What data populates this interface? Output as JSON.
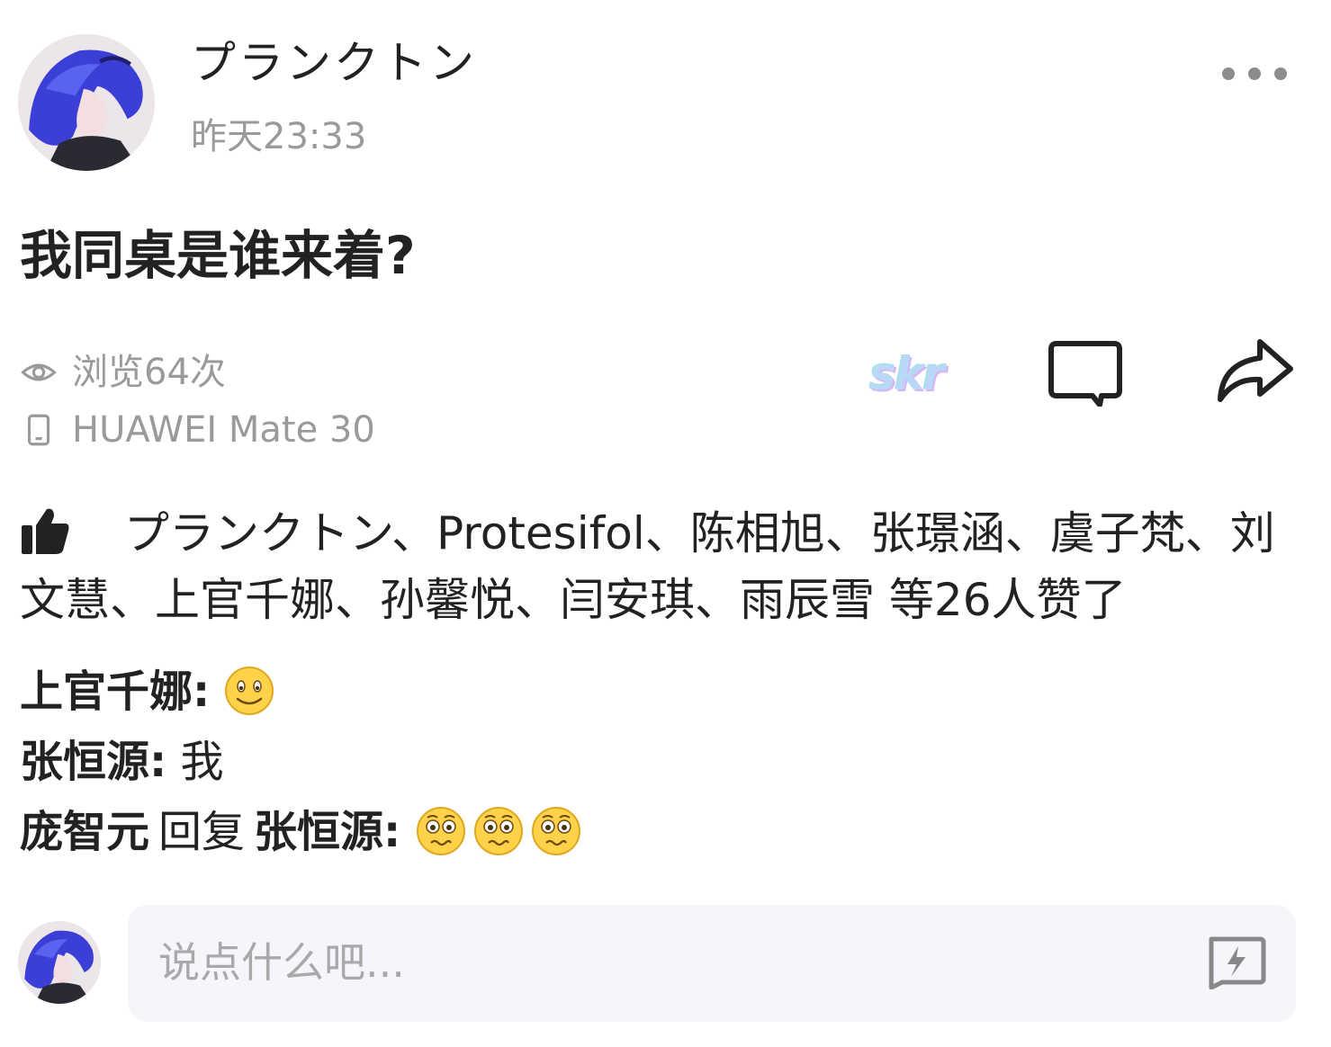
{
  "post": {
    "username": "プランクトン",
    "timestamp": "昨天23:33",
    "text": "我同桌是谁来着?",
    "views": "浏览64次",
    "device": "HUAWEI Mate 30",
    "skr_label": "skr",
    "avatar_icon": "anime-avatar-blue-hair",
    "more_icon": "more-dots-icon"
  },
  "likes": {
    "icon": "thumbs-up-icon",
    "text": "プランクトン、Protesifol、陈相旭、张璟涵、虞子梵、刘文慧、上官千娜、孙馨悦、闫安琪、雨辰雪 等26人赞了"
  },
  "comments": [
    {
      "author": "上官千娜:",
      "text": "",
      "emoji": [
        "smile"
      ]
    },
    {
      "author": "张恒源:",
      "text": "我",
      "emoji": []
    },
    {
      "author": "庞智元",
      "reply_word": "回复",
      "reply_to": "张恒源:",
      "text": "",
      "emoji": [
        "pleading",
        "pleading",
        "pleading"
      ]
    }
  ],
  "composer": {
    "placeholder": "说点什么吧...",
    "flash_icon": "lightning-comment-icon"
  },
  "colors": {
    "primary_text": "#222222",
    "secondary_text": "#9a9a9a",
    "input_bg": "#f4f6fb",
    "emoji_yellow": "#ffd24a"
  }
}
